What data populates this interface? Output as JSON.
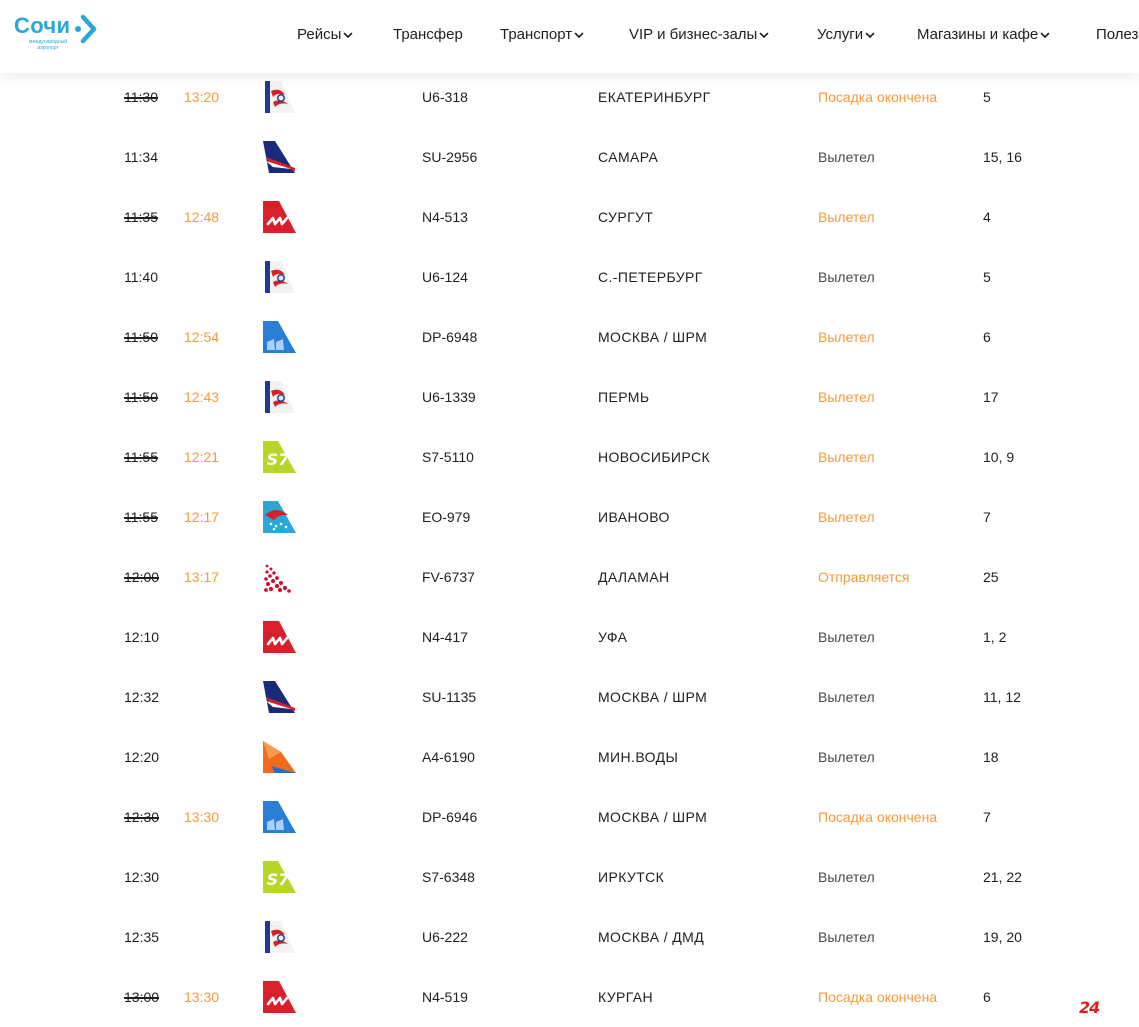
{
  "header": {
    "logo": {
      "title": "Сочи",
      "subtitle": "международный аэропорт"
    },
    "nav": [
      {
        "label": "Рейсы",
        "dropdown": true
      },
      {
        "label": "Трансфер",
        "dropdown": false
      },
      {
        "label": "Транспорт",
        "dropdown": true
      },
      {
        "label": "VIP и бизнес-залы",
        "dropdown": true
      },
      {
        "label": "Услуги",
        "dropdown": true
      },
      {
        "label": "Магазины и кафе",
        "dropdown": true
      },
      {
        "label": "Полезн",
        "dropdown": false
      }
    ]
  },
  "flights": [
    {
      "scheduled": "11:30",
      "actual": "13:20",
      "airline": "ural",
      "flight": "U6-318",
      "destination": "ЕКАТЕРИНБУРГ",
      "status": "Посадка окончена",
      "highlight": true,
      "gate": "5"
    },
    {
      "scheduled": "11:34",
      "actual": "",
      "airline": "aeroflot",
      "flight": "SU-2956",
      "destination": "САМАРА",
      "status": "Вылетел",
      "highlight": false,
      "gate": "15, 16"
    },
    {
      "scheduled": "11:35",
      "actual": "12:48",
      "airline": "nordwind",
      "flight": "N4-513",
      "destination": "СУРГУТ",
      "status": "Вылетел",
      "highlight": true,
      "gate": "4"
    },
    {
      "scheduled": "11:40",
      "actual": "",
      "airline": "ural",
      "flight": "U6-124",
      "destination": "С.-ПЕТЕРБУРГ",
      "status": "Вылетел",
      "highlight": false,
      "gate": "5"
    },
    {
      "scheduled": "11:50",
      "actual": "12:54",
      "airline": "pobeda",
      "flight": "DP-6948",
      "destination": "МОСКВА / ШРМ",
      "status": "Вылетел",
      "highlight": true,
      "gate": "6"
    },
    {
      "scheduled": "11:50",
      "actual": "12:43",
      "airline": "ural",
      "flight": "U6-1339",
      "destination": "ПЕРМЬ",
      "status": "Вылетел",
      "highlight": true,
      "gate": "17"
    },
    {
      "scheduled": "11:55",
      "actual": "12:21",
      "airline": "s7",
      "flight": "S7-5110",
      "destination": "НОВОСИБИРСК",
      "status": "Вылетел",
      "highlight": true,
      "gate": "10, 9"
    },
    {
      "scheduled": "11:55",
      "actual": "12:17",
      "airline": "ikar",
      "flight": "EO-979",
      "destination": "ИВАНОВО",
      "status": "Вылетел",
      "highlight": true,
      "gate": "7"
    },
    {
      "scheduled": "12:00",
      "actual": "13:17",
      "airline": "rossiya",
      "flight": "FV-6737",
      "destination": "ДАЛАМАН",
      "status": "Отправляется",
      "highlight": true,
      "gate": "25"
    },
    {
      "scheduled": "12:10",
      "actual": "",
      "airline": "nordwind",
      "flight": "N4-417",
      "destination": "УФА",
      "status": "Вылетел",
      "highlight": false,
      "gate": "1, 2"
    },
    {
      "scheduled": "12:32",
      "actual": "",
      "airline": "aeroflot",
      "flight": "SU-1135",
      "destination": "МОСКВА / ШРМ",
      "status": "Вылетел",
      "highlight": false,
      "gate": "11, 12"
    },
    {
      "scheduled": "12:20",
      "actual": "",
      "airline": "azimuth",
      "flight": "A4-6190",
      "destination": "МИН.ВОДЫ",
      "status": "Вылетел",
      "highlight": false,
      "gate": "18"
    },
    {
      "scheduled": "12:30",
      "actual": "13:30",
      "airline": "pobeda",
      "flight": "DP-6946",
      "destination": "МОСКВА / ШРМ",
      "status": "Посадка окончена",
      "highlight": true,
      "gate": "7"
    },
    {
      "scheduled": "12:30",
      "actual": "",
      "airline": "s7",
      "flight": "S7-6348",
      "destination": "ИРКУТСК",
      "status": "Вылетел",
      "highlight": false,
      "gate": "21, 22"
    },
    {
      "scheduled": "12:35",
      "actual": "",
      "airline": "ural",
      "flight": "U6-222",
      "destination": "МОСКВА / ДМД",
      "status": "Вылетел",
      "highlight": false,
      "gate": "19, 20"
    },
    {
      "scheduled": "13:00",
      "actual": "13:30",
      "airline": "nordwind",
      "flight": "N4-519",
      "destination": "КУРГАН",
      "status": "Посадка окончена",
      "highlight": true,
      "gate": "6"
    }
  ],
  "watermark": "24",
  "colors": {
    "accent": "#2aa7d6",
    "delayed": "#f29a3a",
    "watermark": "#e0201f"
  }
}
